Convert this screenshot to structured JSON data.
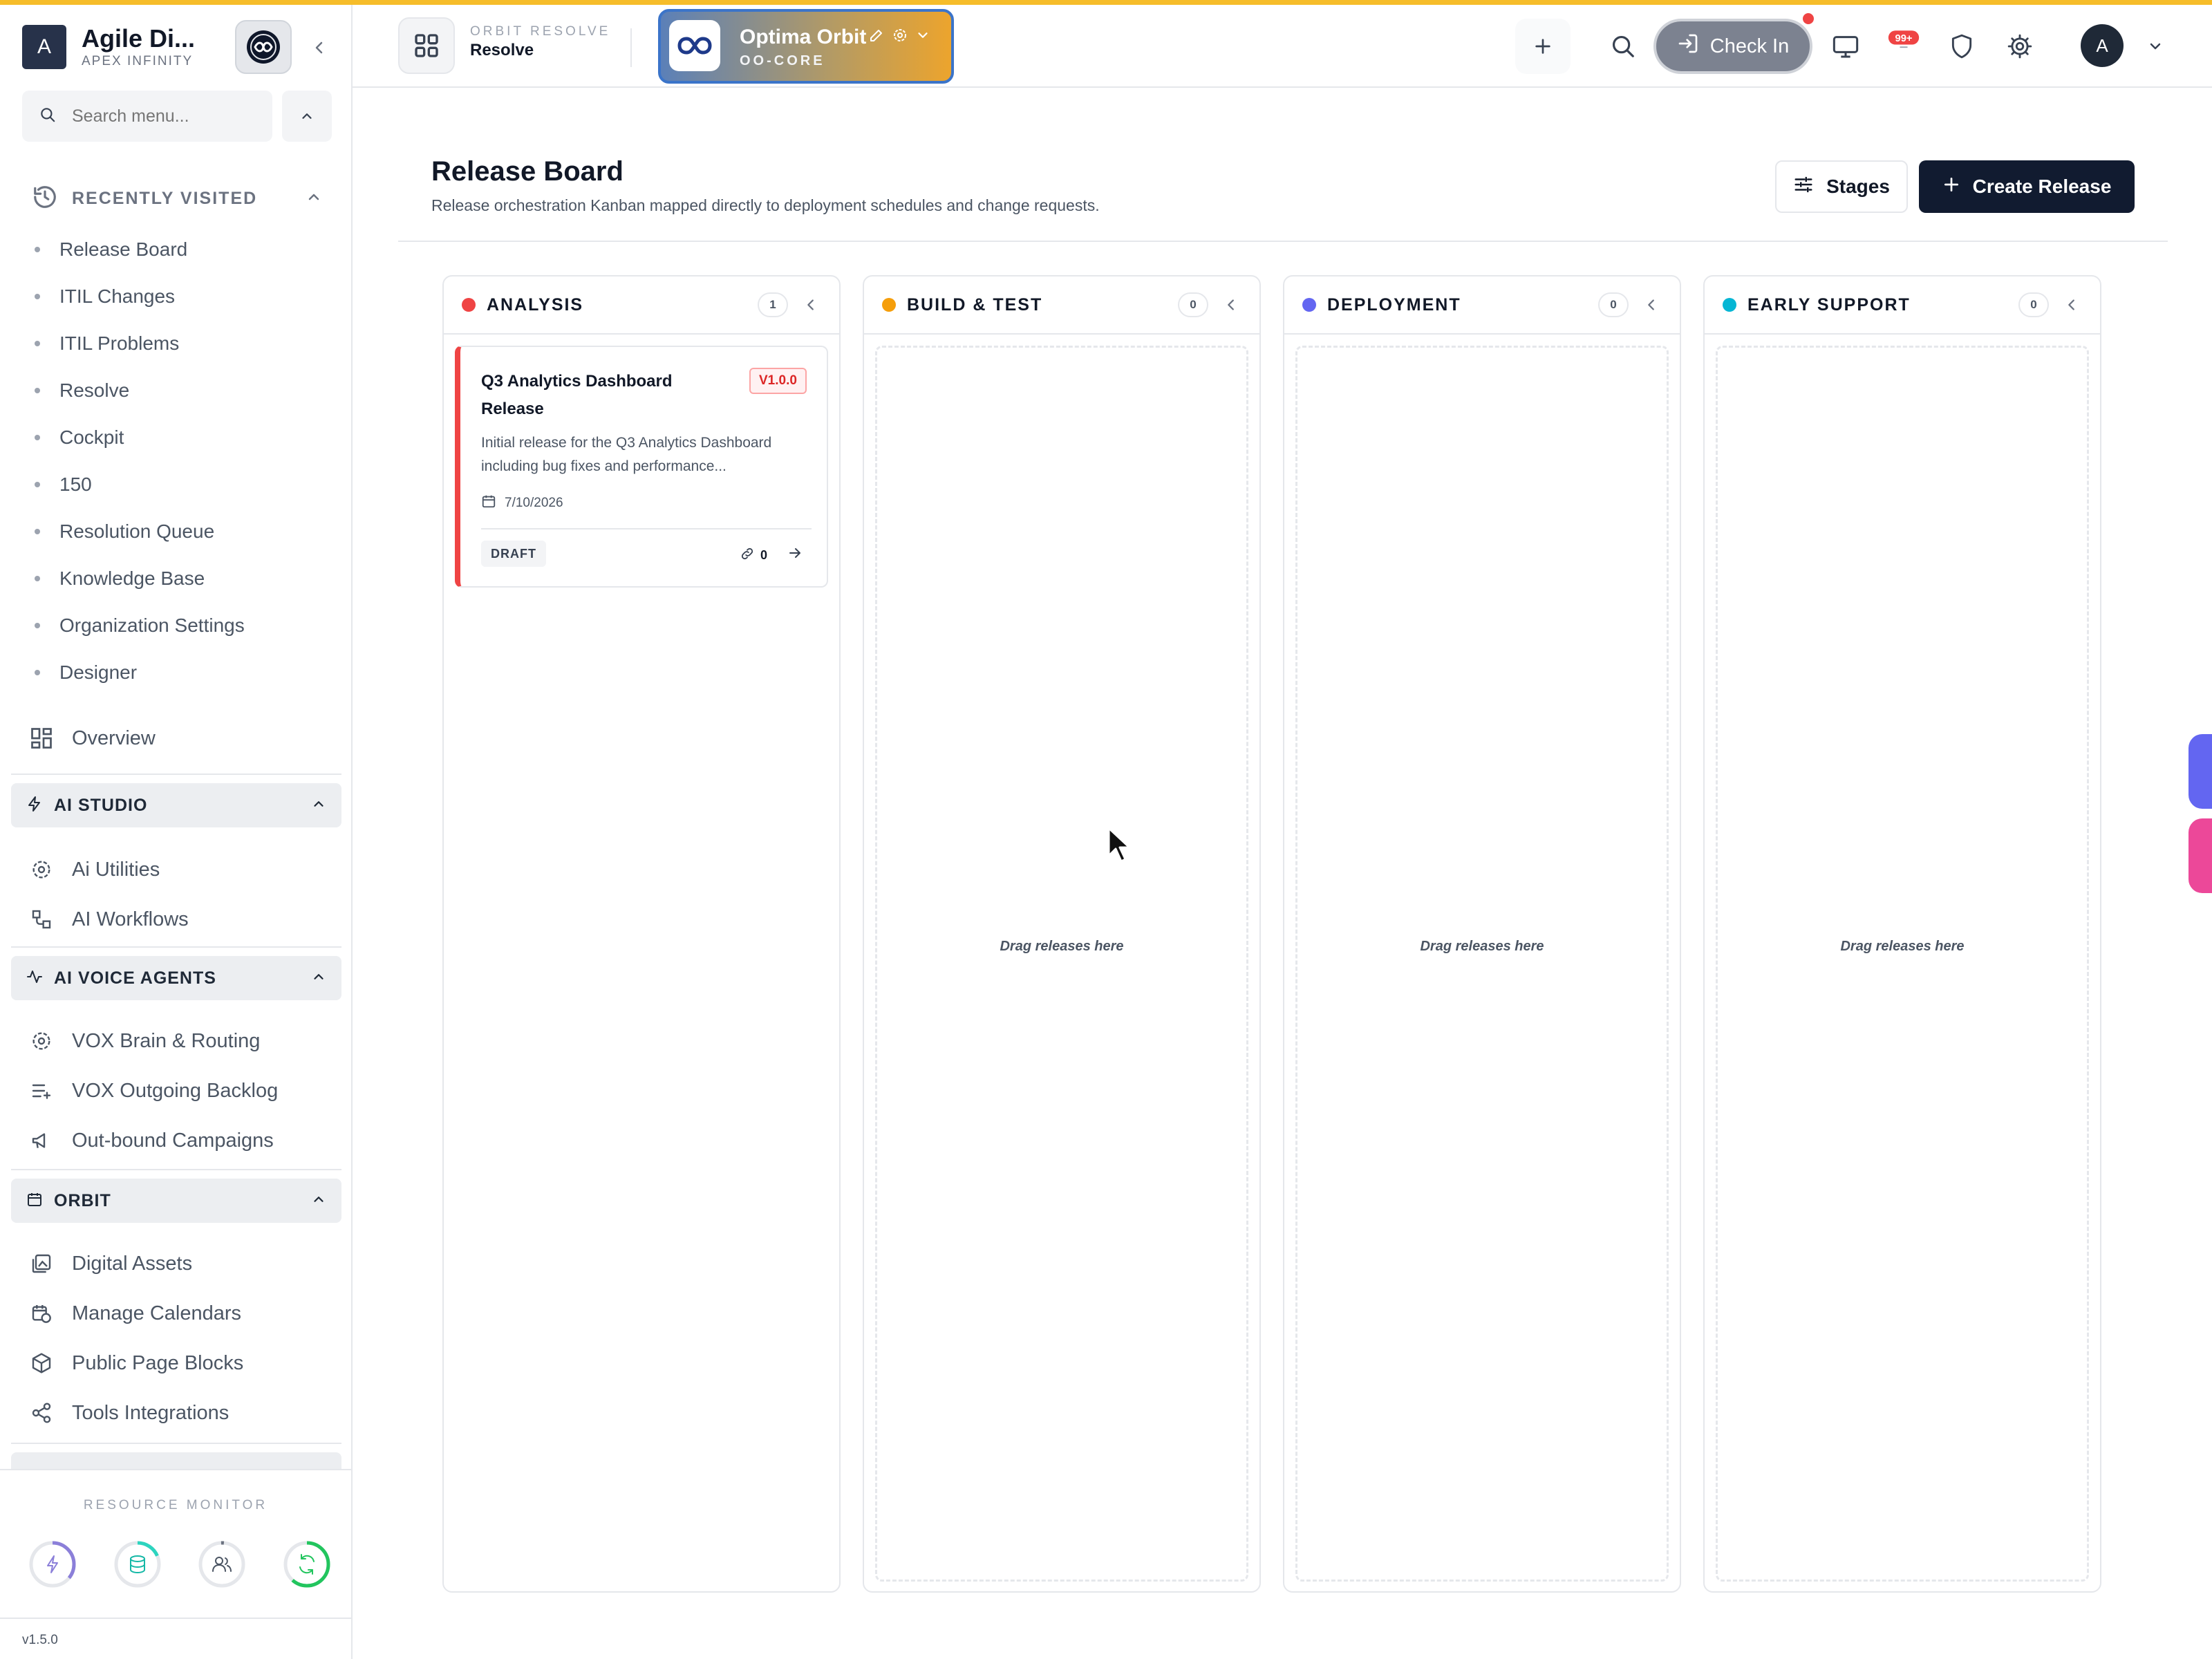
{
  "brand": {
    "badge": "A",
    "title": "Agile Di...",
    "subtitle": "APEX INFINITY"
  },
  "sidebar": {
    "search_placeholder": "Search menu...",
    "recently_visited": {
      "label": "RECENTLY VISITED",
      "items": [
        "Release Board",
        "ITIL Changes",
        "ITIL Problems",
        "Resolve",
        "Cockpit",
        "150",
        "Resolution Queue",
        "Knowledge Base",
        "Organization Settings",
        "Designer"
      ]
    },
    "overview": "Overview",
    "sections": [
      {
        "label": "AI STUDIO",
        "items": [
          "Ai Utilities",
          "AI Workflows"
        ]
      },
      {
        "label": "AI VOICE AGENTS",
        "items": [
          "VOX Brain & Routing",
          "VOX Outgoing Backlog",
          "Out-bound Campaigns"
        ]
      },
      {
        "label": "ORBIT",
        "items": [
          "Digital Assets",
          "Manage Calendars",
          "Public Page Blocks",
          "Tools Integrations"
        ]
      }
    ],
    "resource_monitor": "RESOURCE MONITOR",
    "version": "v1.5.0"
  },
  "header": {
    "app_sub": "ORBIT RESOLVE",
    "app_name": "Resolve",
    "workspace": {
      "name": "Optima Orbit",
      "code": "OO-CORE"
    },
    "check_in": "Check In",
    "notifications_badge": "99+",
    "avatar": "A"
  },
  "main": {
    "title": "Release Board",
    "description": "Release orchestration Kanban mapped directly to deployment schedules and change requests.",
    "stages_button": "Stages",
    "create_button": "Create Release",
    "empty_text": "Drag releases here",
    "columns": [
      {
        "name": "ANALYSIS",
        "count": "1",
        "color": "#ef4444"
      },
      {
        "name": "BUILD & TEST",
        "count": "0",
        "color": "#f59e0b"
      },
      {
        "name": "DEPLOYMENT",
        "count": "0",
        "color": "#6366f1"
      },
      {
        "name": "EARLY SUPPORT",
        "count": "0",
        "color": "#06b6d4"
      }
    ],
    "card": {
      "title": "Q3 Analytics Dashboard Release",
      "version": "V1.0.0",
      "description": "Initial release for the Q3 Analytics Dashboard including bug fixes and performance...",
      "date": "7/10/2026",
      "status": "DRAFT",
      "links": "0"
    }
  }
}
